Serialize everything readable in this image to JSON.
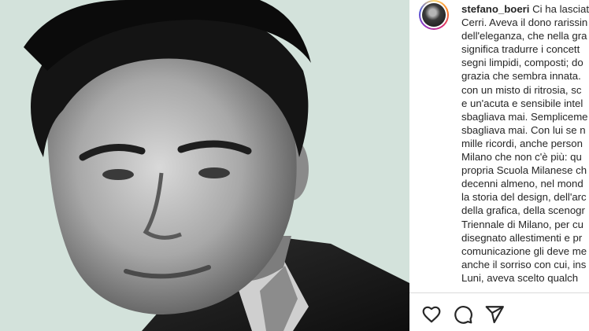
{
  "post": {
    "image": {
      "subject": "black-and-white portrait photo",
      "background_color": "#d3e2db"
    },
    "author": {
      "username": "stefano_boeri"
    },
    "caption": {
      "first_line_text": "Ci ha lasciat",
      "lines": [
        "Cerri. Aveva il dono rarissin",
        "dell'eleganza, che nella gra",
        "significa tradurre i concett",
        "segni limpidi, composti; do",
        "grazia che sembra innata.",
        "con un misto di ritrosia, sc",
        "e un'acuta e sensibile intel",
        "sbagliava mai. Sempliceme",
        "sbagliava mai. Con lui se n",
        "mille ricordi, anche person",
        "Milano che non c'è più: qu",
        "propria Scuola Milanese ch",
        "decenni almeno, nel mond",
        "la storia del design, dell'arc",
        "della grafica, della scenogr",
        "Triennale di Milano, per cu",
        "disegnato allestimenti e pr",
        "comunicazione gli deve me",
        "anche il sorriso con cui, ins",
        "Luni, aveva scelto qualch"
      ]
    }
  },
  "actions": {
    "like": "heart-icon",
    "comment": "comment-bubble-icon",
    "share": "paper-plane-icon"
  },
  "colors": {
    "text": "#262626",
    "divider": "#dbdbdb",
    "accent_ring": "#d62976"
  }
}
